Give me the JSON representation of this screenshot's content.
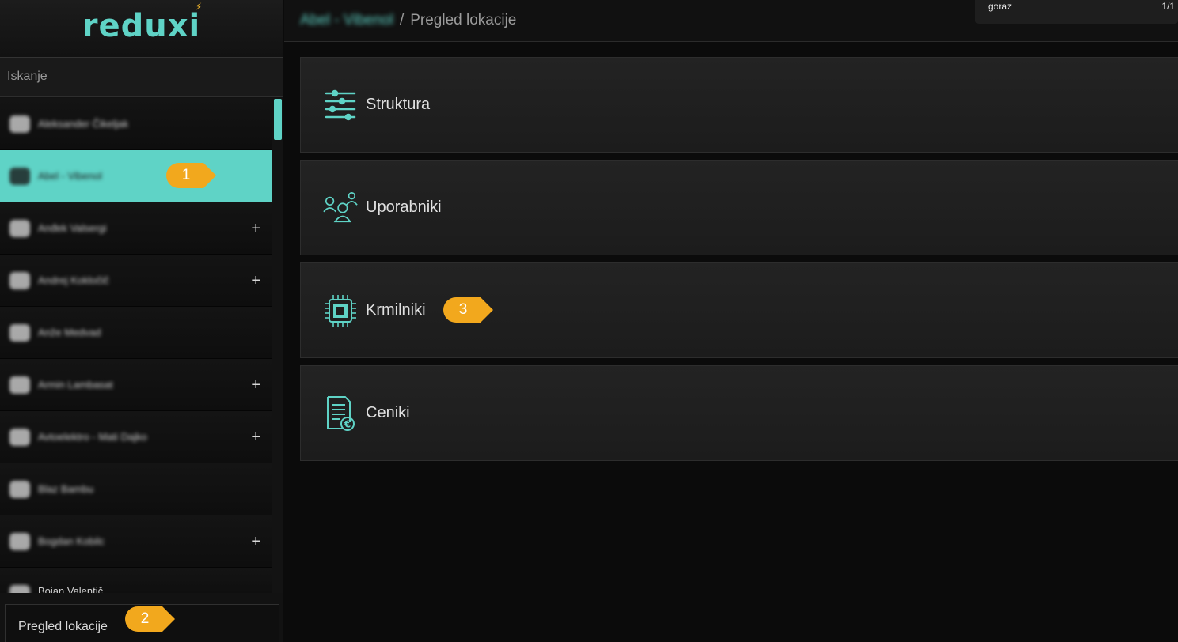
{
  "app": {
    "logo": "reduxi"
  },
  "search": {
    "placeholder": "Iskanje"
  },
  "tree": {
    "items": [
      {
        "label": "Aleksander Čikeljak",
        "has_expand": false,
        "selected": false
      },
      {
        "label": "Abel - Vibenol",
        "has_expand": false,
        "selected": true
      },
      {
        "label": "Anđek Valsergi",
        "has_expand": true,
        "selected": false
      },
      {
        "label": "Andrej Kokločič",
        "has_expand": true,
        "selected": false
      },
      {
        "label": "Anže Medvad",
        "has_expand": false,
        "selected": false
      },
      {
        "label": "Armin Lambasat",
        "has_expand": true,
        "selected": false
      },
      {
        "label": "Avtoelektro - Mati Dajko",
        "has_expand": true,
        "selected": false
      },
      {
        "label": "Blaz Bambu",
        "has_expand": false,
        "selected": false
      },
      {
        "label": "Bogdan Kobilc",
        "has_expand": true,
        "selected": false
      },
      {
        "label": "Bojan Valentič",
        "has_expand": false,
        "selected": false
      }
    ],
    "expand_symbol": "+"
  },
  "bottom_panel": {
    "label": "Pregled lokacije"
  },
  "header": {
    "crumb_parent": "Abel - Vibenol",
    "separator": "/",
    "crumb_current": "Pregled lokacije"
  },
  "find_bar": {
    "query": "goraz",
    "count": "1/1"
  },
  "cards": [
    {
      "label": "Struktura",
      "icon": "sliders-icon"
    },
    {
      "label": "Uporabniki",
      "icon": "users-icon"
    },
    {
      "label": "Krmilniki",
      "icon": "chip-icon"
    },
    {
      "label": "Ceniki",
      "icon": "pricelist-icon"
    }
  ],
  "callouts": [
    {
      "number": "1"
    },
    {
      "number": "2"
    },
    {
      "number": "3"
    }
  ],
  "colors": {
    "accent": "#5fd3c6",
    "callout": "#f2a81d",
    "background": "#0b0b0b"
  }
}
